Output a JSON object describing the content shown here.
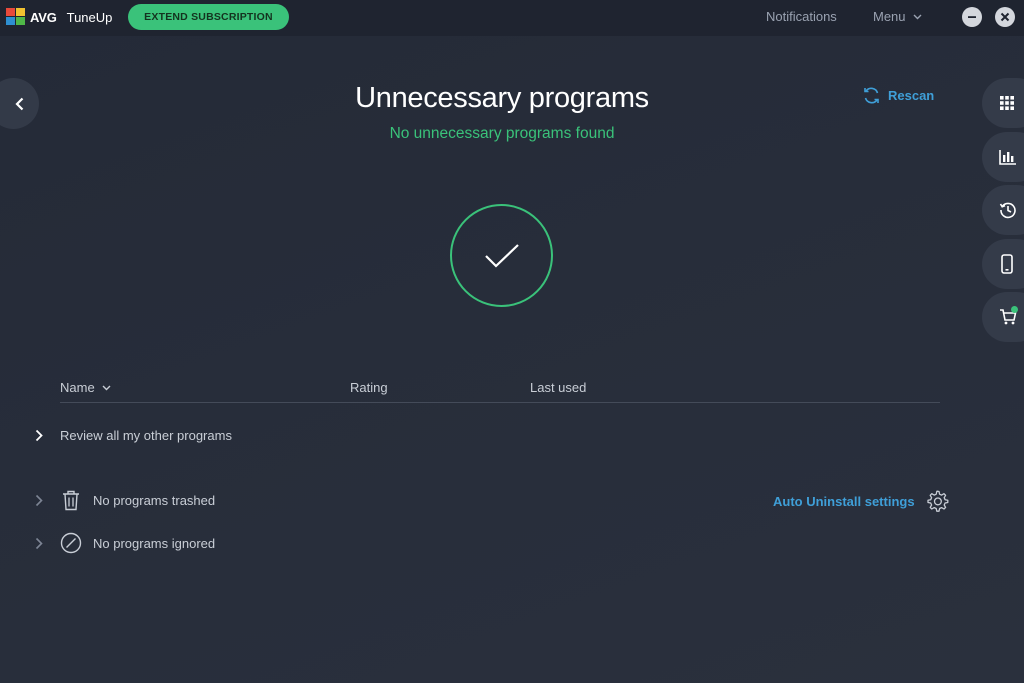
{
  "topbar": {
    "brand": "AVG",
    "product": "TuneUp",
    "extend_label": "EXTEND SUBSCRIPTION",
    "notifications_label": "Notifications",
    "menu_label": "Menu"
  },
  "header": {
    "title": "Unnecessary programs",
    "subtitle": "No unnecessary programs found",
    "rescan_label": "Rescan"
  },
  "table": {
    "columns": [
      "Name",
      "Rating",
      "Last used"
    ],
    "review_label": "Review all my other programs"
  },
  "summary": {
    "trashed_label": "No programs trashed",
    "ignored_label": "No programs ignored",
    "auto_uninstall_label": "Auto Uninstall settings"
  },
  "icons": {
    "back": "chevron-left-icon",
    "rail": [
      "apps-grid-icon",
      "performance-chart-icon",
      "history-icon",
      "mobile-device-icon",
      "cart-icon"
    ],
    "status": "checkmark-icon"
  },
  "colors": {
    "accent_green": "#3ac27a",
    "link_blue": "#3f9fd8",
    "background": "#272d3a",
    "topbar": "#1f2430"
  }
}
